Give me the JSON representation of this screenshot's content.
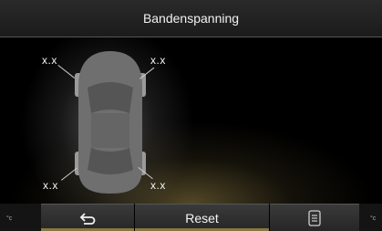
{
  "header": {
    "title": "Bandenspanning"
  },
  "tires": {
    "front_left": "x.x",
    "front_right": "x.x",
    "rear_left": "x.x",
    "rear_right": "x.x"
  },
  "units": {
    "left": "°c",
    "right": "°c"
  },
  "toolbar": {
    "back_icon": "back-arrow-icon",
    "reset_label": "Reset",
    "list_icon": "list-icon"
  },
  "colors": {
    "background": "#000000",
    "glow": "#8a7640",
    "car": "#6b6b6b"
  }
}
